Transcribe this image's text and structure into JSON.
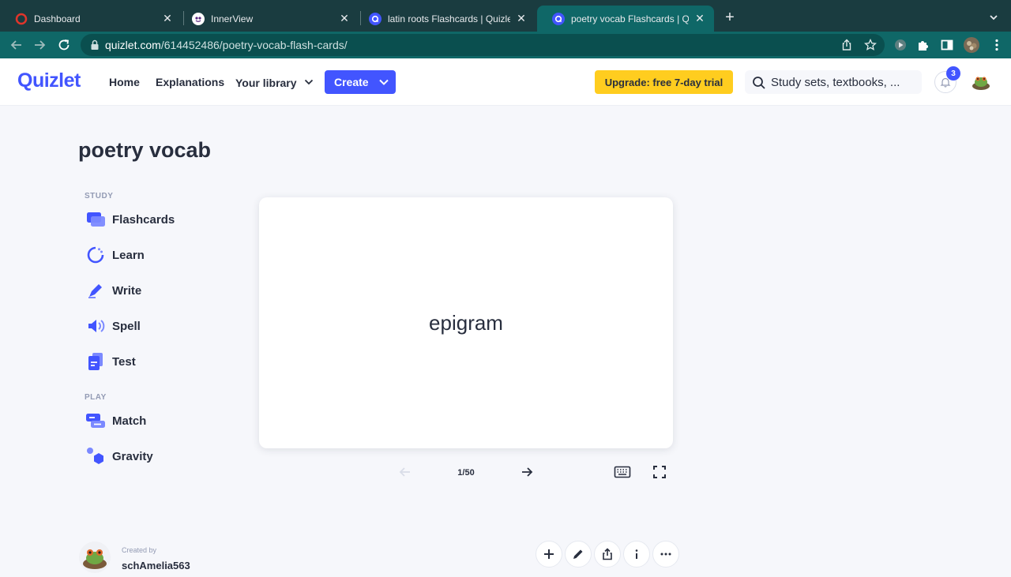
{
  "browser": {
    "tabs": [
      {
        "title": "Dashboard",
        "active": false
      },
      {
        "title": "InnerView",
        "active": false
      },
      {
        "title": "latin roots Flashcards | Quizlet",
        "active": false
      },
      {
        "title": "poetry vocab Flashcards | Quizlet",
        "active": true
      }
    ],
    "url_host": "quizlet.com",
    "url_path": "/614452486/poetry-vocab-flash-cards/"
  },
  "header": {
    "logo": "Quizlet",
    "nav": {
      "home": "Home",
      "explanations": "Explanations",
      "library": "Your library"
    },
    "create_label": "Create",
    "upgrade_label": "Upgrade: free 7-day trial",
    "search_placeholder": "Study sets, textbooks, ...",
    "notification_count": "3"
  },
  "set": {
    "title": "poetry vocab"
  },
  "study": {
    "section_label": "STUDY",
    "modes": [
      "Flashcards",
      "Learn",
      "Write",
      "Spell",
      "Test"
    ]
  },
  "play": {
    "section_label": "PLAY",
    "modes": [
      "Match",
      "Gravity"
    ]
  },
  "card": {
    "term": "epigram",
    "counter": "1/50",
    "progress": {
      "current": 1,
      "total": 50
    }
  },
  "creator": {
    "label": "Created by",
    "name": "schAmelia563"
  },
  "colors": {
    "brand": "#4255ff",
    "upgrade": "#ffcd1f",
    "chrome_tabbar": "#1a3c40",
    "chrome_toolbar": "#0f6767"
  },
  "icons": [
    "back-arrow-icon",
    "forward-arrow-icon",
    "reload-icon",
    "lock-icon",
    "share-icon",
    "star-icon",
    "extensions-icon",
    "sidebar-icon",
    "search-icon",
    "bell-icon",
    "keyboard-icon",
    "fullscreen-icon",
    "plus-icon",
    "pencil-icon",
    "info-icon",
    "more-icon"
  ]
}
